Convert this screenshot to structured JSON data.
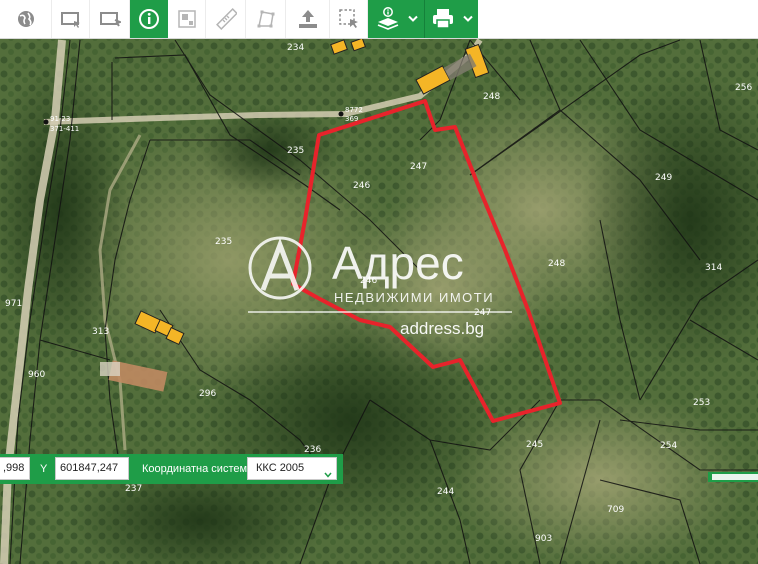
{
  "toolbar": {
    "icons": [
      "globe-icon",
      "select-area-icon",
      "select-object-icon",
      "info-icon",
      "measure-area-icon",
      "ruler-icon",
      "polygon-icon",
      "upload-icon",
      "selection-icon",
      "layers-info-icon",
      "print-icon"
    ],
    "active_colors": {
      "green": "#1f9d48",
      "icon_gray": "#8c8c8c"
    }
  },
  "map": {
    "parcel_labels": [
      "234",
      "248",
      "256",
      "235",
      "247",
      "246",
      "249",
      "235",
      "248",
      "314",
      "971",
      "313",
      "960",
      "296",
      "236",
      "253",
      "254",
      "245",
      "237",
      "244",
      "709",
      "903",
      "246",
      "247"
    ],
    "point_labels": {
      "left_point": "91-23",
      "left_point_sub": "371-411",
      "road_point": "8772",
      "road_point_sub": "369"
    },
    "highlight_color": "#e8232b",
    "building_color": "#f4b526"
  },
  "watermark": {
    "brand": "Адрес",
    "tagline": "НЕДВИЖИМИ ИМОТИ",
    "url": "address.bg"
  },
  "coords": {
    "x_value": ",998",
    "y_label": "Y",
    "y_value": "601847,247",
    "system_label": "Координатна система",
    "system_value": "ККС 2005"
  }
}
